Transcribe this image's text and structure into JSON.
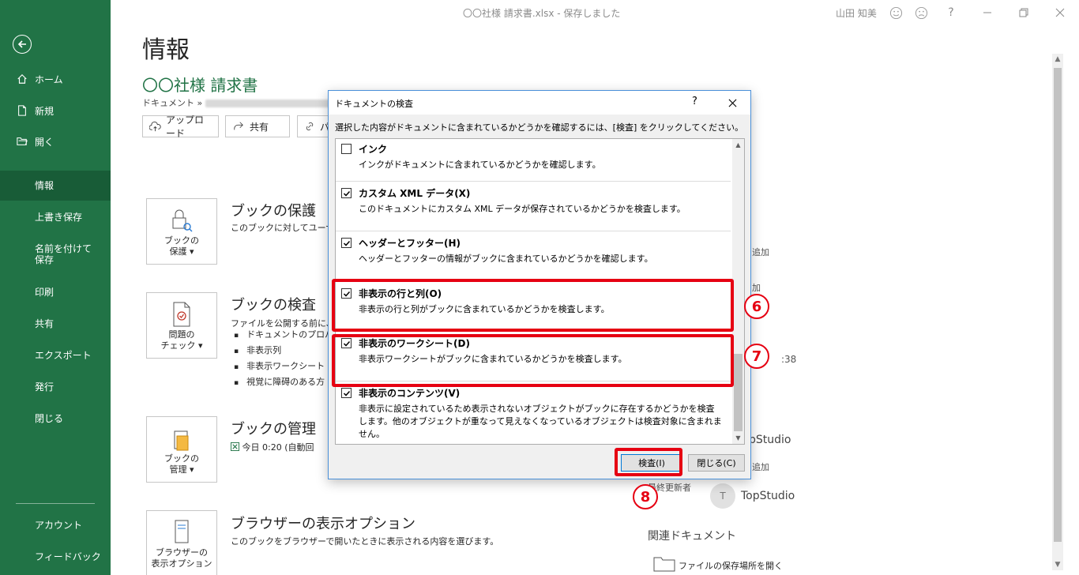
{
  "window": {
    "title": "〇〇社様 請求書.xlsx  -  保存しました",
    "user": "山田 知美",
    "help_glyph": "?"
  },
  "sidebar": {
    "top_items": [
      {
        "label": "ホーム",
        "icon": "home-icon"
      },
      {
        "label": "新規",
        "icon": "new-document-icon"
      },
      {
        "label": "開く",
        "icon": "open-folder-icon"
      }
    ],
    "items": [
      {
        "label": "情報",
        "active": true
      },
      {
        "label": "上書き保存"
      },
      {
        "label": "名前を付けて保存"
      },
      {
        "label": "印刷"
      },
      {
        "label": "共有"
      },
      {
        "label": "エクスポート"
      },
      {
        "label": "発行"
      },
      {
        "label": "閉じる"
      }
    ],
    "bottom_items": [
      {
        "label": "アカウント"
      },
      {
        "label": "フィードバック"
      }
    ]
  },
  "main": {
    "title": "情報",
    "doc_name": "〇〇社様 請求書",
    "doc_path_prefix": "ドキュメント »",
    "buttons": {
      "upload": "アップロード",
      "share": "共有",
      "link": "パ"
    },
    "sections": [
      {
        "card_label_1": "ブックの",
        "card_label_2": "保護",
        "title": "ブックの保護",
        "desc": "このブックに対してユーザー"
      },
      {
        "card_label_1": "問題の",
        "card_label_2": "チェック",
        "title": "ブックの検査",
        "desc": "ファイルを公開する前に、フ",
        "bullets": [
          "ドキュメントのプロパテ",
          "非表示列",
          "非表示ワークシート",
          "視覚に障碍のある方"
        ]
      },
      {
        "card_label_1": "ブックの",
        "card_label_2": "管理",
        "title": "ブックの管理",
        "desc": "今日 0:20 (自動回"
      },
      {
        "card_label_1": "ブラウザーの",
        "card_label_2": "表示オプション",
        "title": "ブラウザーの表示オプション",
        "desc": "このブックをブラウザーで開いたときに表示される内容を選びます。"
      }
    ],
    "right_panel": {
      "frag_1": "追加",
      "frag_2": "加",
      "frag_3": ":38",
      "frag_4": "pStudio",
      "frag_5": "追加",
      "last_modified_by": "最終更新者",
      "avatar_initial": "T",
      "author": "TopStudio",
      "related_heading": "関連ドキュメント",
      "open_location": "ファイルの保存場所を開く"
    }
  },
  "dialog": {
    "title": "ドキュメントの検査",
    "help": "?",
    "instruction": "選択した内容がドキュメントに含まれているかどうかを確認するには、[検査] をクリックしてください。",
    "items": [
      {
        "name": "インク",
        "desc": "インクがドキュメントに含まれているかどうかを確認します。",
        "checked": false
      },
      {
        "name": "カスタム XML データ(X)",
        "desc": "このドキュメントにカスタム XML データが保存されているかどうかを検査します。",
        "checked": true
      },
      {
        "name": "ヘッダーとフッター(H)",
        "desc": "ヘッダーとフッターの情報がブックに含まれているかどうかを確認します。",
        "checked": true
      },
      {
        "name": "非表示の行と列(O)",
        "desc": "非表示の行と列がブックに含まれているかどうかを検査します。",
        "checked": true
      },
      {
        "name": "非表示のワークシート(D)",
        "desc": "非表示ワークシートがブックに含まれているかどうかを検査します。",
        "checked": true
      },
      {
        "name": "非表示のコンテンツ(V)",
        "desc": "非表示に設定されているため表示されないオブジェクトがブックに存在するかどうかを検査します。他のオブジェクトが重なって見えなくなっているオブジェクトは検査対象に含まれません。",
        "checked": true
      }
    ],
    "inspect_button": "検査(I)",
    "close_button": "閉じる(C)"
  },
  "annotations": {
    "badge_6": "6",
    "badge_7": "7",
    "badge_8": "8",
    "highlight_color": "#e60012"
  },
  "colors": {
    "excel_green": "#217346",
    "sidebar_active": "#185c37"
  }
}
